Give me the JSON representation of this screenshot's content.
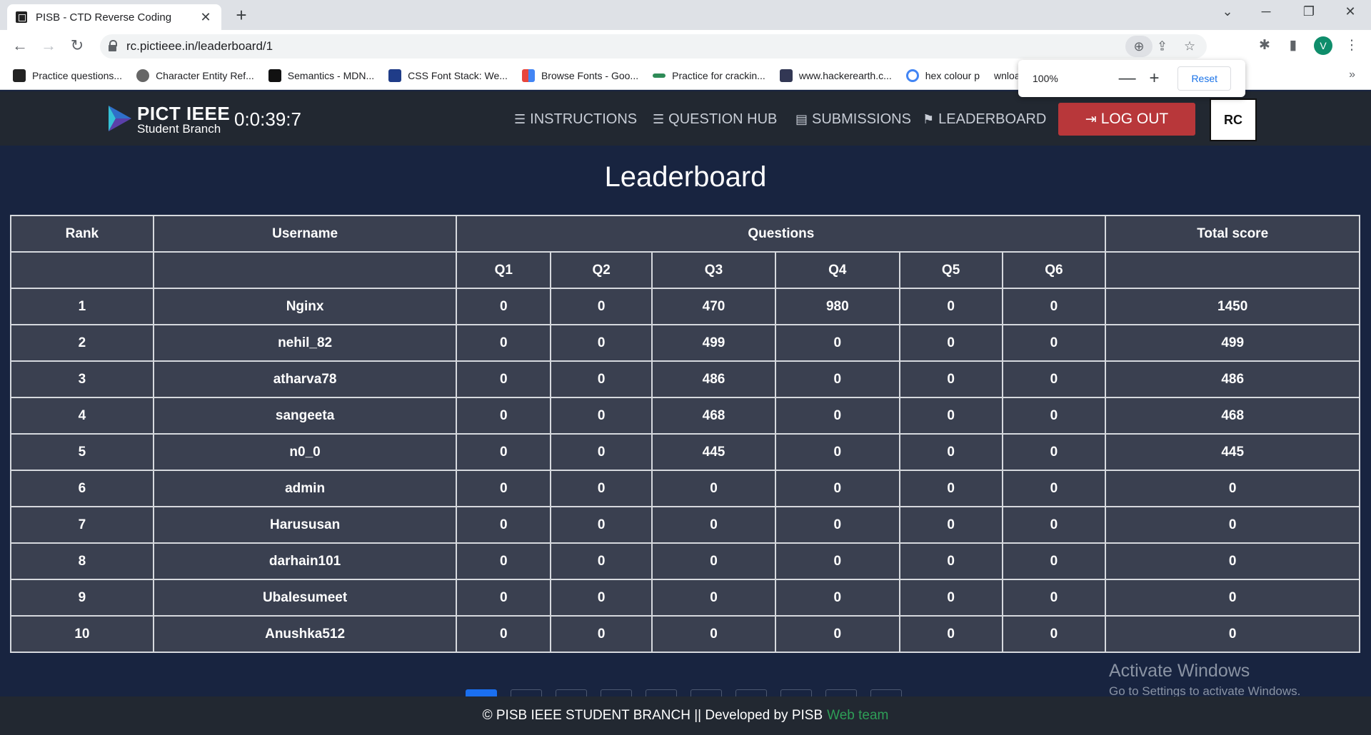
{
  "browser": {
    "tab_title": "PISB - CTD Reverse Coding",
    "url": "rc.pictieee.in/leaderboard/1",
    "profile_initial": "V",
    "bookmarks": [
      {
        "label": "Practice questions...",
        "color": "#222222"
      },
      {
        "label": "Character Entity Ref...",
        "color": "#555555"
      },
      {
        "label": "Semantics - MDN...",
        "color": "#111111"
      },
      {
        "label": "CSS Font Stack: We...",
        "color": "#1f3c88"
      },
      {
        "label": "Browse Fonts - Goo...",
        "color": "#e8453c"
      },
      {
        "label": "Practice for crackin...",
        "color": "#2e8b57"
      },
      {
        "label": "www.hackerearth.c...",
        "color": "#323754"
      },
      {
        "label": "hex colour p",
        "color": "#4285f4"
      },
      {
        "label": "wnload Free Op...",
        "color": "#ffffff"
      }
    ],
    "zoom_popup": {
      "level": "100%",
      "minus": "—",
      "plus": "+",
      "reset": "Reset"
    }
  },
  "header": {
    "brand_line1": "PICT IEEE",
    "brand_line2": "Student Branch",
    "timer": "0:0:39:7",
    "nav": [
      {
        "label": "INSTRUCTIONS",
        "icon": "list-icon"
      },
      {
        "label": "QUESTION HUB",
        "icon": "list-icon"
      },
      {
        "label": "SUBMISSIONS",
        "icon": "file-code-icon"
      },
      {
        "label": "LEADERBOARD",
        "icon": "flag-checkered-icon"
      }
    ],
    "logout_label": "LOG OUT",
    "rc_logo_text": "RC"
  },
  "main": {
    "title": "Leaderboard",
    "table": {
      "headers": {
        "rank": "Rank",
        "username": "Username",
        "questions": "Questions",
        "total": "Total score"
      },
      "question_cols": [
        "Q1",
        "Q2",
        "Q3",
        "Q4",
        "Q5",
        "Q6"
      ],
      "rows": [
        {
          "rank": "1",
          "username": "Nginx",
          "q": [
            "0",
            "0",
            "470",
            "980",
            "0",
            "0"
          ],
          "total": "1450"
        },
        {
          "rank": "2",
          "username": "nehil_82",
          "q": [
            "0",
            "0",
            "499",
            "0",
            "0",
            "0"
          ],
          "total": "499"
        },
        {
          "rank": "3",
          "username": "atharva78",
          "q": [
            "0",
            "0",
            "486",
            "0",
            "0",
            "0"
          ],
          "total": "486"
        },
        {
          "rank": "4",
          "username": "sangeeta",
          "q": [
            "0",
            "0",
            "468",
            "0",
            "0",
            "0"
          ],
          "total": "468"
        },
        {
          "rank": "5",
          "username": "n0_0",
          "q": [
            "0",
            "0",
            "445",
            "0",
            "0",
            "0"
          ],
          "total": "445"
        },
        {
          "rank": "6",
          "username": "admin",
          "q": [
            "0",
            "0",
            "0",
            "0",
            "0",
            "0"
          ],
          "total": "0"
        },
        {
          "rank": "7",
          "username": "Harususan",
          "q": [
            "0",
            "0",
            "0",
            "0",
            "0",
            "0"
          ],
          "total": "0"
        },
        {
          "rank": "8",
          "username": "darhain101",
          "q": [
            "0",
            "0",
            "0",
            "0",
            "0",
            "0"
          ],
          "total": "0"
        },
        {
          "rank": "9",
          "username": "Ubalesumeet",
          "q": [
            "0",
            "0",
            "0",
            "0",
            "0",
            "0"
          ],
          "total": "0"
        },
        {
          "rank": "10",
          "username": "Anushka512",
          "q": [
            "0",
            "0",
            "0",
            "0",
            "0",
            "0"
          ],
          "total": "0"
        }
      ]
    }
  },
  "watermark": {
    "line1": "Activate Windows",
    "line2": "Go to Settings to activate Windows."
  },
  "footer": {
    "text": "© PISB IEEE STUDENT BRANCH || Developed by PISB",
    "link": "Web team"
  }
}
